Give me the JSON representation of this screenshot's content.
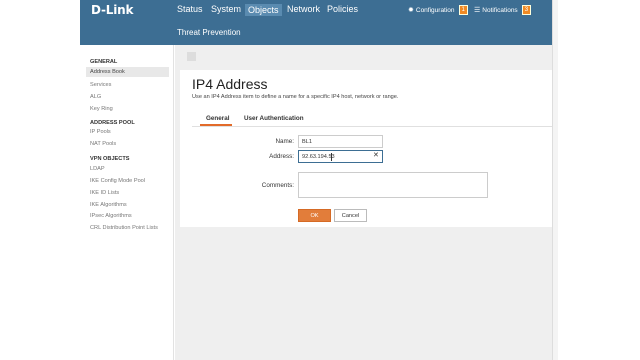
{
  "header": {
    "logo": "D-Link",
    "nav": [
      "Status",
      "System",
      "Objects",
      "Network",
      "Policies"
    ],
    "active_nav": "Objects",
    "subnav": "Threat Prevention",
    "configuration": {
      "label": "Configuration",
      "count": "1"
    },
    "notifications": {
      "label": "Notifications",
      "count": "3"
    },
    "colors": {
      "header_bg": "#3d6e93",
      "accent": "#e27d3a"
    }
  },
  "sidebar": {
    "general": {
      "heading": "GENERAL",
      "items": [
        "Address Book",
        "Services",
        "ALG",
        "Key Ring"
      ]
    },
    "address_pool": {
      "heading": "ADDRESS POOL",
      "items": [
        "IP Pools",
        "NAT Pools"
      ]
    },
    "vpn_objects": {
      "heading": "VPN OBJECTS",
      "items": [
        "LDAP",
        "IKE Config Mode Pool",
        "IKE ID Lists",
        "IKE Algorithms",
        "IPsec Algorithms",
        "CRL Distribution Point Lists"
      ]
    },
    "active_item": "Address Book"
  },
  "main": {
    "title": "IP4 Address",
    "description": "Use an IP4 Address item to define a name for a specific IP4 host, network or range.",
    "tabs": [
      "General",
      "User Authentication"
    ],
    "active_tab": "General",
    "form": {
      "name_label": "Name:",
      "name_value": "BL1",
      "address_label": "Address:",
      "address_value": "92.63.194.53",
      "comments_label": "Comments:",
      "comments_value": ""
    },
    "buttons": {
      "ok": "OK",
      "cancel": "Cancel"
    }
  }
}
